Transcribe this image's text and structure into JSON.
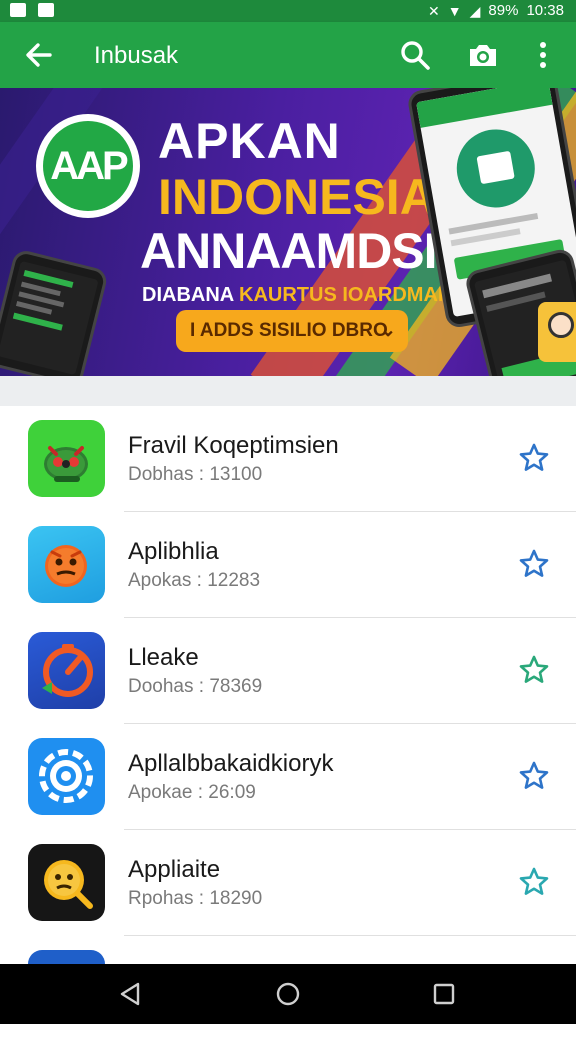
{
  "status_bar": {
    "battery": "89%",
    "time": "10:38"
  },
  "app_bar": {
    "title": "Inbusak"
  },
  "banner": {
    "logo_text": "AAP",
    "line1": "APKAN",
    "line2": "INDONESIA",
    "line3": "ANNAAMDSIN",
    "subtitle_white": "DIABANA ",
    "subtitle_yellow": "KAURTUS IOARDMARICIS",
    "cta_label": "I ADDS SISILIO DBRO",
    "cta_chevron": "⌄"
  },
  "apps": [
    {
      "name": "Fravil Koqeptimsien",
      "meta": "Dobhas : 13100",
      "icon": "green-robot-icon",
      "star_color": "#2e74c9"
    },
    {
      "name": "Aplibhlia",
      "meta": "Apokas : 12283",
      "icon": "orange-face-icon",
      "star_color": "#2e74c9"
    },
    {
      "name": "Lleake",
      "meta": "Doohas : 78369",
      "icon": "blue-timer-icon",
      "star_color": "#2aa87a"
    },
    {
      "name": "Apllalbbakaidkioryk",
      "meta": "Apokae : 26:09",
      "icon": "gear-icon",
      "star_color": "#2e74c9"
    },
    {
      "name": "Appliaite",
      "meta": "Rpohas : 18290",
      "icon": "yellow-face-icon",
      "star_color": "#2aa8b0"
    }
  ],
  "colors": {
    "status_bar": "#1e8a3c",
    "app_bar": "#23a347",
    "banner_bg": "#4a1fa0",
    "accent_yellow": "#f6b81e"
  }
}
